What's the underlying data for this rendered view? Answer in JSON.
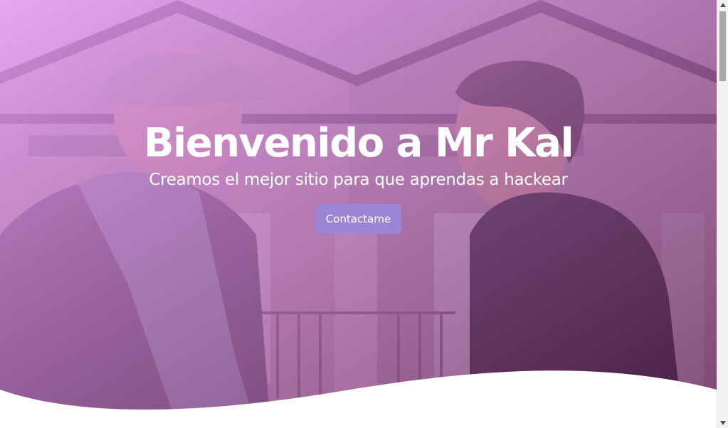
{
  "hero": {
    "title": "Bienvenido a Mr Kal",
    "subtitle": "Creamos el mejor sitio para que aprendas a hackear",
    "cta_label": "Contactame",
    "photo_icon": "hero-background-photo",
    "colors": {
      "overlay_start": "#e9a6f2",
      "overlay_end": "#6b2f6a",
      "button": "#9b86d6",
      "text": "#ffffff",
      "page_bg": "#ffffff"
    }
  },
  "scrollbar": {
    "up_icon": "scroll-up-arrow-icon",
    "down_icon": "scroll-down-arrow-icon",
    "track_color": "#f1f1f1",
    "thumb_color": "#a8a8a8"
  }
}
